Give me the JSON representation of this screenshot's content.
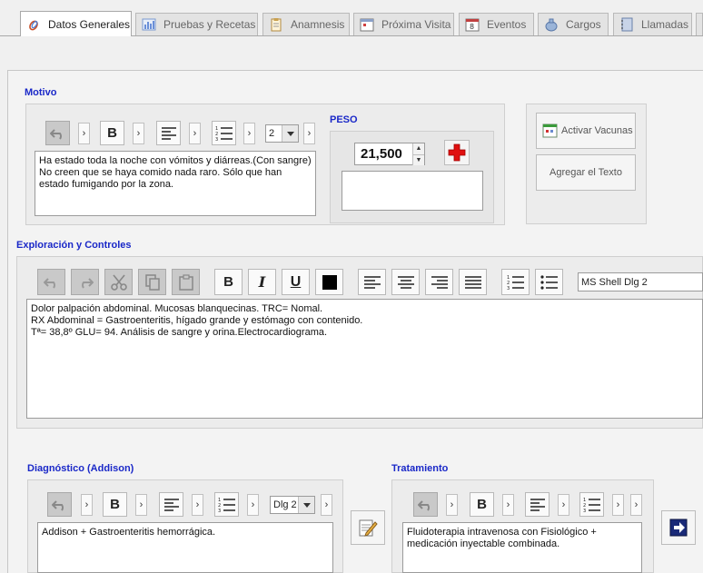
{
  "tabs": [
    {
      "label": "Datos Generales",
      "active": true
    },
    {
      "label": "Pruebas y Recetas"
    },
    {
      "label": "Anamnesis"
    },
    {
      "label": "Próxima Visita"
    },
    {
      "label": "Eventos"
    },
    {
      "label": "Cargos"
    },
    {
      "label": "Llamadas"
    }
  ],
  "motivo": {
    "title": "Motivo",
    "list_size": "2",
    "text": "Ha estado toda la noche con vómitos y diárreas.(Con sangre)\nNo creen que se haya comido nada raro. Sólo que han estado fumigando por la zona."
  },
  "peso": {
    "title": "PESO",
    "value": "21,500"
  },
  "actions": {
    "vacunas_label": "Activar Vacunas",
    "agregar_label": "Agregar el Texto"
  },
  "exploracion": {
    "title": "Exploración y Controles",
    "font_name": "MS Shell Dlg 2",
    "text": "Dolor palpación abdominal. Mucosas blanquecinas. TRC= Nomal.\nRX Abdominal = Gastroenteritis, hígado grande y estómago con contenido.\nTª= 38,8º  GLU= 94. Análisis de sangre y orina.Electrocardiograma."
  },
  "diagnostico": {
    "title": "Diagnóstico (Addison)",
    "font_name": "Dlg 2",
    "text": "Addison + Gastroenteritis hemorrágica."
  },
  "tratamiento": {
    "title": "Tratamiento",
    "text": "Fluidoterapia intravenosa con Fisiológico +\nmedicación inyectable combinada."
  },
  "colors": {
    "section_title": "#1a28c8",
    "cross": "#e01010"
  }
}
